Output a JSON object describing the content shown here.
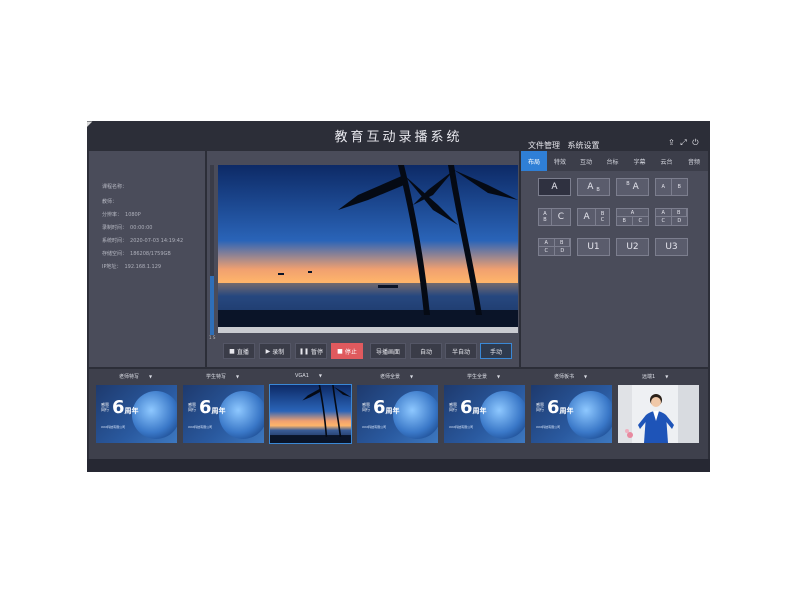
{
  "app": {
    "title": "教育互动录播系统",
    "menu": {
      "file_manage": "文件管理",
      "system_settings": "系统设置"
    }
  },
  "info": {
    "course_name_label": "课程名称：",
    "teacher_label": "教师：",
    "resolution_label": "分辨率：",
    "resolution_value": "1080P",
    "record_time_label": "录制时间：",
    "record_time_value": "00:00:00",
    "system_time_label": "系统时间：",
    "system_time_value": "2020-07-03 14:19:42",
    "storage_label": "存储空间：",
    "storage_value": "186208/1759GB",
    "ip_label": "IP地址：",
    "ip_value": "192.168.1.129"
  },
  "preview": {
    "vu_level": 0.35,
    "vu_label": "1 S"
  },
  "controls": {
    "live": "直播",
    "record": "录制",
    "pause": "暂停",
    "stop": "停止",
    "guide_screen": "导播画面",
    "auto": "自动",
    "semi_auto": "半自动",
    "manual": "手动"
  },
  "tabs": [
    "布局",
    "特效",
    "互动",
    "台标",
    "字幕",
    "云台",
    "音频"
  ],
  "layouts": {
    "single": "A",
    "a": "A",
    "b": "B",
    "c": "C",
    "d": "D",
    "u1": "U1",
    "u2": "U2",
    "u3": "U3"
  },
  "thumbnails": [
    {
      "label": "老师特写",
      "type": "slide"
    },
    {
      "label": "学生特写",
      "type": "slide"
    },
    {
      "label": "VGA1",
      "type": "vga"
    },
    {
      "label": "老师全景",
      "type": "slide"
    },
    {
      "label": "学生全景",
      "type": "slide"
    },
    {
      "label": "老师板书",
      "type": "slide"
    },
    {
      "label": "远端1",
      "type": "person"
    }
  ],
  "slide": {
    "number": "6",
    "suffix": "周年",
    "line1": "感恩",
    "line2": "同行",
    "company": "XXX科技有限公司"
  },
  "colors": {
    "background": "#2c2e38",
    "panel": "#4a4c5a",
    "accent": "#2f7fd6",
    "stop": "#e05a5e"
  }
}
